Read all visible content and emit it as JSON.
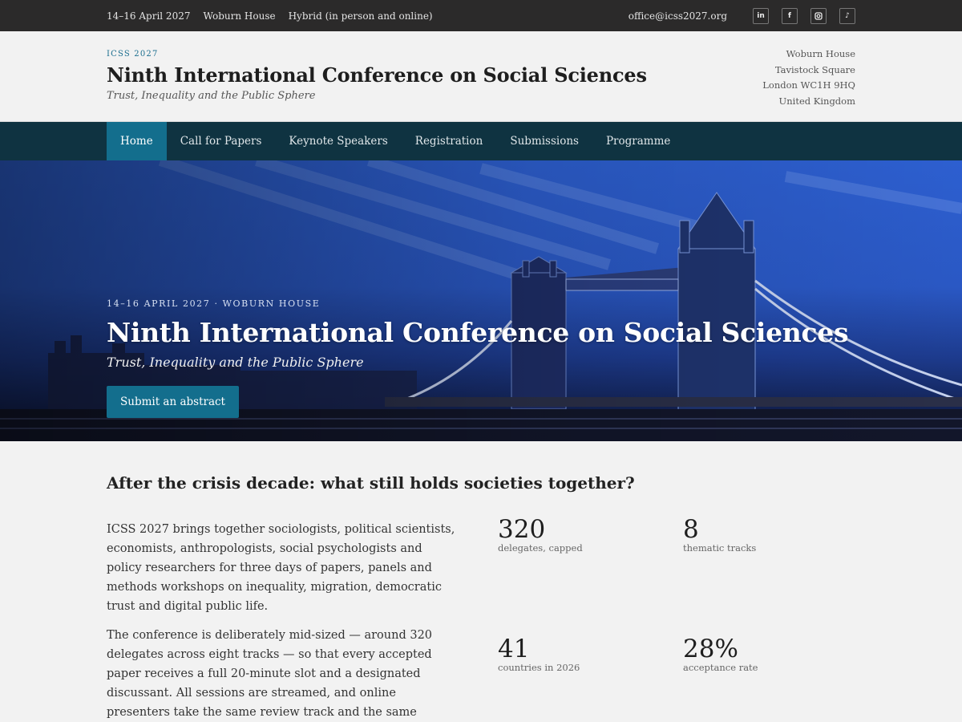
{
  "topbar": {
    "dates": "14–16 April 2027",
    "venue": "Woburn House",
    "format": "Hybrid (in person and online)",
    "email": "office@icss2027.org",
    "social": [
      {
        "name": "linkedin-icon",
        "glyph": "in"
      },
      {
        "name": "facebook-icon",
        "glyph": "f"
      },
      {
        "name": "instagram-icon",
        "glyph": ""
      },
      {
        "name": "tiktok-icon",
        "glyph": "♪"
      }
    ]
  },
  "header": {
    "kicker": "ICSS 2027",
    "title": "Ninth International Conference on Social Sciences",
    "subtitle": "Trust, Inequality and the Public Sphere",
    "address": [
      "Woburn House",
      "Tavistock Square",
      "London WC1H 9HQ",
      "United Kingdom"
    ]
  },
  "nav": {
    "items": [
      "Home",
      "Call for Papers",
      "Keynote Speakers",
      "Registration",
      "Submissions",
      "Programme"
    ],
    "active": "Home"
  },
  "hero": {
    "kicker": "14–16 APRIL 2027 · WOBURN HOUSE",
    "title": "Ninth International Conference on Social Sciences",
    "subtitle": "Trust, Inequality and the Public Sphere",
    "button": "Submit an abstract"
  },
  "main": {
    "heading": "After the crisis decade: what still holds societies together?",
    "paragraphs": [
      "ICSS 2027 brings together sociologists, political scientists, economists, anthropologists, social psychologists and policy researchers for three days of papers, panels and methods workshops on inequality, migration, democratic trust and digital public life.",
      "The conference is deliberately mid-sized — around 320 delegates across eight tracks — so that every accepted paper receives a full 20-minute slot and a designated discussant. All sessions are streamed, and online presenters take the same review track and the same proceedings as those in the room."
    ],
    "stats": [
      {
        "value": "320",
        "label": "delegates, capped"
      },
      {
        "value": "8",
        "label": "thematic tracks"
      },
      {
        "value": "41",
        "label": "countries in 2026"
      },
      {
        "value": "28%",
        "label": "acceptance rate"
      }
    ]
  },
  "colors": {
    "topbar": "#2b2a2a",
    "nav": "#0f3341",
    "accent": "#136e8d",
    "background": "#f2f2f2"
  }
}
